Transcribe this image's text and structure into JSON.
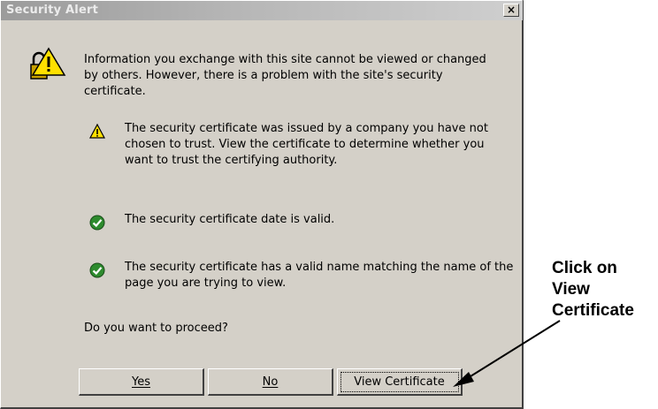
{
  "dialog": {
    "title": "Security Alert",
    "close_label": "×",
    "intro": "Information you exchange with this site cannot be viewed or changed by others. However, there is a problem with the site's security certificate.",
    "items": [
      {
        "icon": "warning-icon",
        "text": "The security certificate was issued by a company you have not chosen to trust. View the certificate to determine whether you want to trust the certifying authority."
      },
      {
        "icon": "check-icon",
        "text": "The security certificate date is valid."
      },
      {
        "icon": "check-icon",
        "text": "The security certificate has a valid name matching the name of the page you are trying to view."
      }
    ],
    "question": "Do you want to proceed?",
    "buttons": {
      "yes": "Yes",
      "no": "No",
      "view_certificate": "View Certificate"
    }
  },
  "annotation": {
    "line1": "Click on",
    "line2": "View",
    "line3": "Certificate"
  },
  "colors": {
    "warning_yellow": "#ffe000",
    "check_green": "#2e8b2e",
    "dialog_face": "#d4d0c8"
  }
}
